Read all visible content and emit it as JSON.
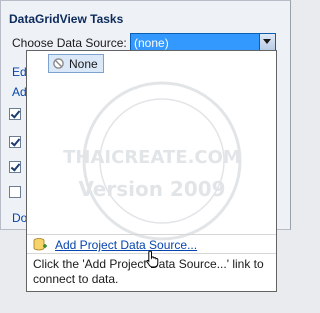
{
  "panel": {
    "title": "DataGridView Tasks",
    "choose_label": "Choose Data Source:",
    "combo_value": "(none)",
    "peek_items": [
      "Edi",
      "Ad",
      "Do"
    ],
    "peek_checkboxes": [
      true,
      true,
      true,
      false
    ]
  },
  "dropdown": {
    "tree_item": "None",
    "add_link": "Add Project Data Source...",
    "help_text": "Click the 'Add Project Data Source...' link to connect to data."
  },
  "watermark": {
    "site": "THAICREATE.COM",
    "version": "Version 2009"
  },
  "colors": {
    "combo_selected": "#3399ff",
    "link": "#0645ad",
    "tree_selection": "#dbe8f7"
  }
}
